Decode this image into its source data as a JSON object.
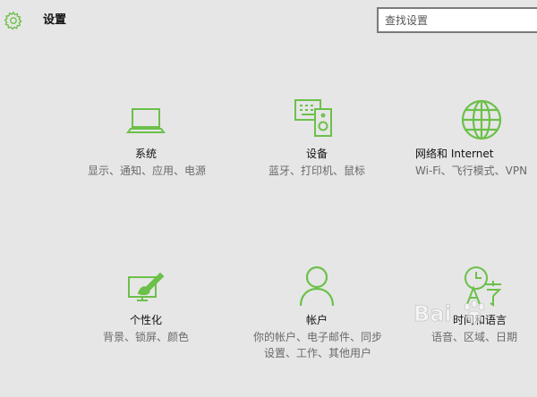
{
  "header": {
    "title": "设置",
    "settings_icon": "gear-icon",
    "search_placeholder": "查找设置"
  },
  "accent_color": "#6cc04a",
  "tiles": [
    {
      "icon": "laptop-icon",
      "title": "系统",
      "desc": "显示、通知、应用、电源"
    },
    {
      "icon": "keyboard-speaker-icon",
      "title": "设备",
      "desc": "蓝牙、打印机、鼠标"
    },
    {
      "icon": "globe-icon",
      "title": "网络和 Internet",
      "desc": "Wi-Fi、飞行模式、VPN"
    },
    {
      "icon": "paint-monitor-icon",
      "title": "个性化",
      "desc": "背景、锁屏、颜色"
    },
    {
      "icon": "person-icon",
      "title": "帐户",
      "desc": "你的帐户、电子邮件、同步设置、工作、其他用户"
    },
    {
      "icon": "time-language-icon",
      "title": "时间和语言",
      "desc": "语音、区域、日期"
    }
  ],
  "watermark": {
    "text": "Bai",
    "icon": "baidu-paw-icon"
  }
}
